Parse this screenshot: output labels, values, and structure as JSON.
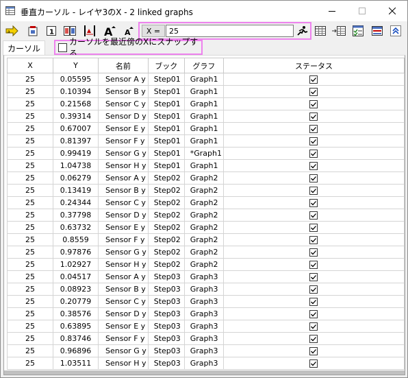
{
  "window": {
    "title": "垂直カーソル - レイヤ3のX - 2 linked graphs",
    "icon": "window-grid-icon"
  },
  "toolbar": {
    "x_label": "X =",
    "x_value": "25",
    "icons": [
      "yellow-arrow-icon",
      "copy-image-icon",
      "number-one-icon",
      "double-pages-icon",
      "cursor-lines-icon",
      "large-a-icon",
      "small-a-icon",
      "run-icon",
      "data-table-icon",
      "export-table-icon",
      "check-list-icon",
      "layout-icon",
      "expand-up-icon"
    ]
  },
  "tabs": [
    {
      "label": "カーソル",
      "active": true
    }
  ],
  "snap_option": {
    "label": "カーソルを最近傍のXにスナップする",
    "checked": false
  },
  "grid": {
    "columns": [
      "X",
      "Y",
      "名前",
      "ブック",
      "グラフ",
      "ステータス"
    ],
    "rows": [
      {
        "x": "25",
        "y": "0.05595",
        "name": "Sensor A y",
        "book": "Step01",
        "graph": "Graph1",
        "status": true
      },
      {
        "x": "25",
        "y": "0.10394",
        "name": "Sensor B y",
        "book": "Step01",
        "graph": "Graph1",
        "status": true
      },
      {
        "x": "25",
        "y": "0.21568",
        "name": "Sensor C y",
        "book": "Step01",
        "graph": "Graph1",
        "status": true
      },
      {
        "x": "25",
        "y": "0.39314",
        "name": "Sensor D y",
        "book": "Step01",
        "graph": "Graph1",
        "status": true
      },
      {
        "x": "25",
        "y": "0.67007",
        "name": "Sensor E y",
        "book": "Step01",
        "graph": "Graph1",
        "status": true
      },
      {
        "x": "25",
        "y": "0.81397",
        "name": "Sensor F y",
        "book": "Step01",
        "graph": "Graph1",
        "status": true
      },
      {
        "x": "25",
        "y": "0.99419",
        "name": "Sensor G y",
        "book": "Step01",
        "graph": "*Graph1",
        "status": true
      },
      {
        "x": "25",
        "y": "1.04738",
        "name": "Sensor H y",
        "book": "Step01",
        "graph": "Graph1",
        "status": true
      },
      {
        "x": "25",
        "y": "0.06279",
        "name": "Sensor A y",
        "book": "Step02",
        "graph": "Graph2",
        "status": true
      },
      {
        "x": "25",
        "y": "0.13419",
        "name": "Sensor B y",
        "book": "Step02",
        "graph": "Graph2",
        "status": true
      },
      {
        "x": "25",
        "y": "0.24344",
        "name": "Sensor C y",
        "book": "Step02",
        "graph": "Graph2",
        "status": true
      },
      {
        "x": "25",
        "y": "0.37798",
        "name": "Sensor D y",
        "book": "Step02",
        "graph": "Graph2",
        "status": true
      },
      {
        "x": "25",
        "y": "0.63732",
        "name": "Sensor E y",
        "book": "Step02",
        "graph": "Graph2",
        "status": true
      },
      {
        "x": "25",
        "y": "0.8559",
        "name": "Sensor F y",
        "book": "Step02",
        "graph": "Graph2",
        "status": true
      },
      {
        "x": "25",
        "y": "0.97876",
        "name": "Sensor G y",
        "book": "Step02",
        "graph": "Graph2",
        "status": true
      },
      {
        "x": "25",
        "y": "1.02927",
        "name": "Sensor H y",
        "book": "Step02",
        "graph": "Graph2",
        "status": true
      },
      {
        "x": "25",
        "y": "0.04517",
        "name": "Sensor A y",
        "book": "Step03",
        "graph": "Graph3",
        "status": true
      },
      {
        "x": "25",
        "y": "0.08923",
        "name": "Sensor B y",
        "book": "Step03",
        "graph": "Graph3",
        "status": true
      },
      {
        "x": "25",
        "y": "0.20779",
        "name": "Sensor C y",
        "book": "Step03",
        "graph": "Graph3",
        "status": true
      },
      {
        "x": "25",
        "y": "0.38576",
        "name": "Sensor D y",
        "book": "Step03",
        "graph": "Graph3",
        "status": true
      },
      {
        "x": "25",
        "y": "0.63895",
        "name": "Sensor E y",
        "book": "Step03",
        "graph": "Graph3",
        "status": true
      },
      {
        "x": "25",
        "y": "0.83746",
        "name": "Sensor F y",
        "book": "Step03",
        "graph": "Graph3",
        "status": true
      },
      {
        "x": "25",
        "y": "0.96896",
        "name": "Sensor G y",
        "book": "Step03",
        "graph": "Graph3",
        "status": true
      },
      {
        "x": "25",
        "y": "1.03511",
        "name": "Sensor H y",
        "book": "Step03",
        "graph": "Graph3",
        "status": true
      }
    ]
  },
  "colors": {
    "highlight": "#ee82ee",
    "window_bg": "#f0f0f0",
    "grid_line": "#d4d4d4"
  }
}
